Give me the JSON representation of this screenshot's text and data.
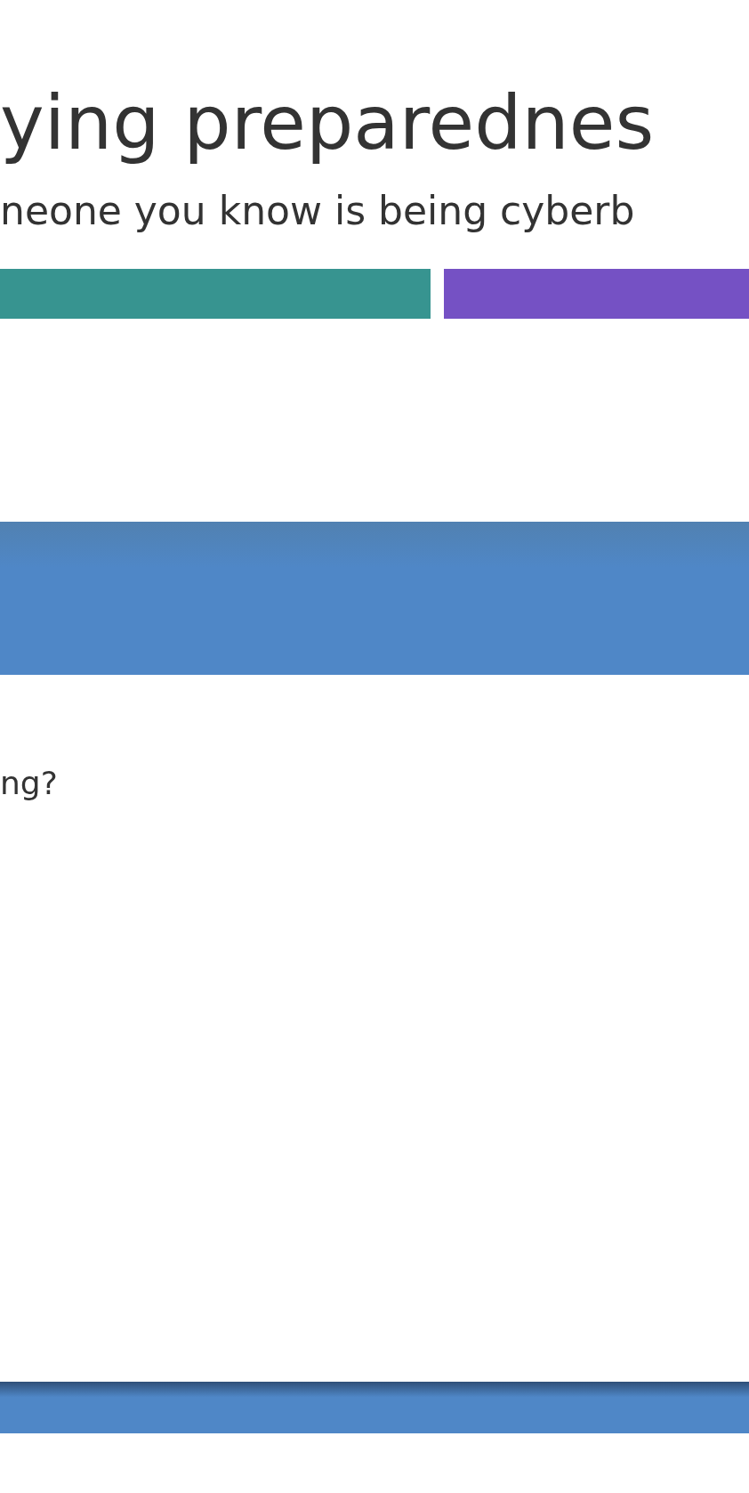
{
  "title": "ying preparednes",
  "subtitle": "neone you know is being cyberb",
  "progress": [
    {
      "color": "#379490"
    },
    {
      "color": "#7551c4"
    }
  ],
  "question": "ng?"
}
